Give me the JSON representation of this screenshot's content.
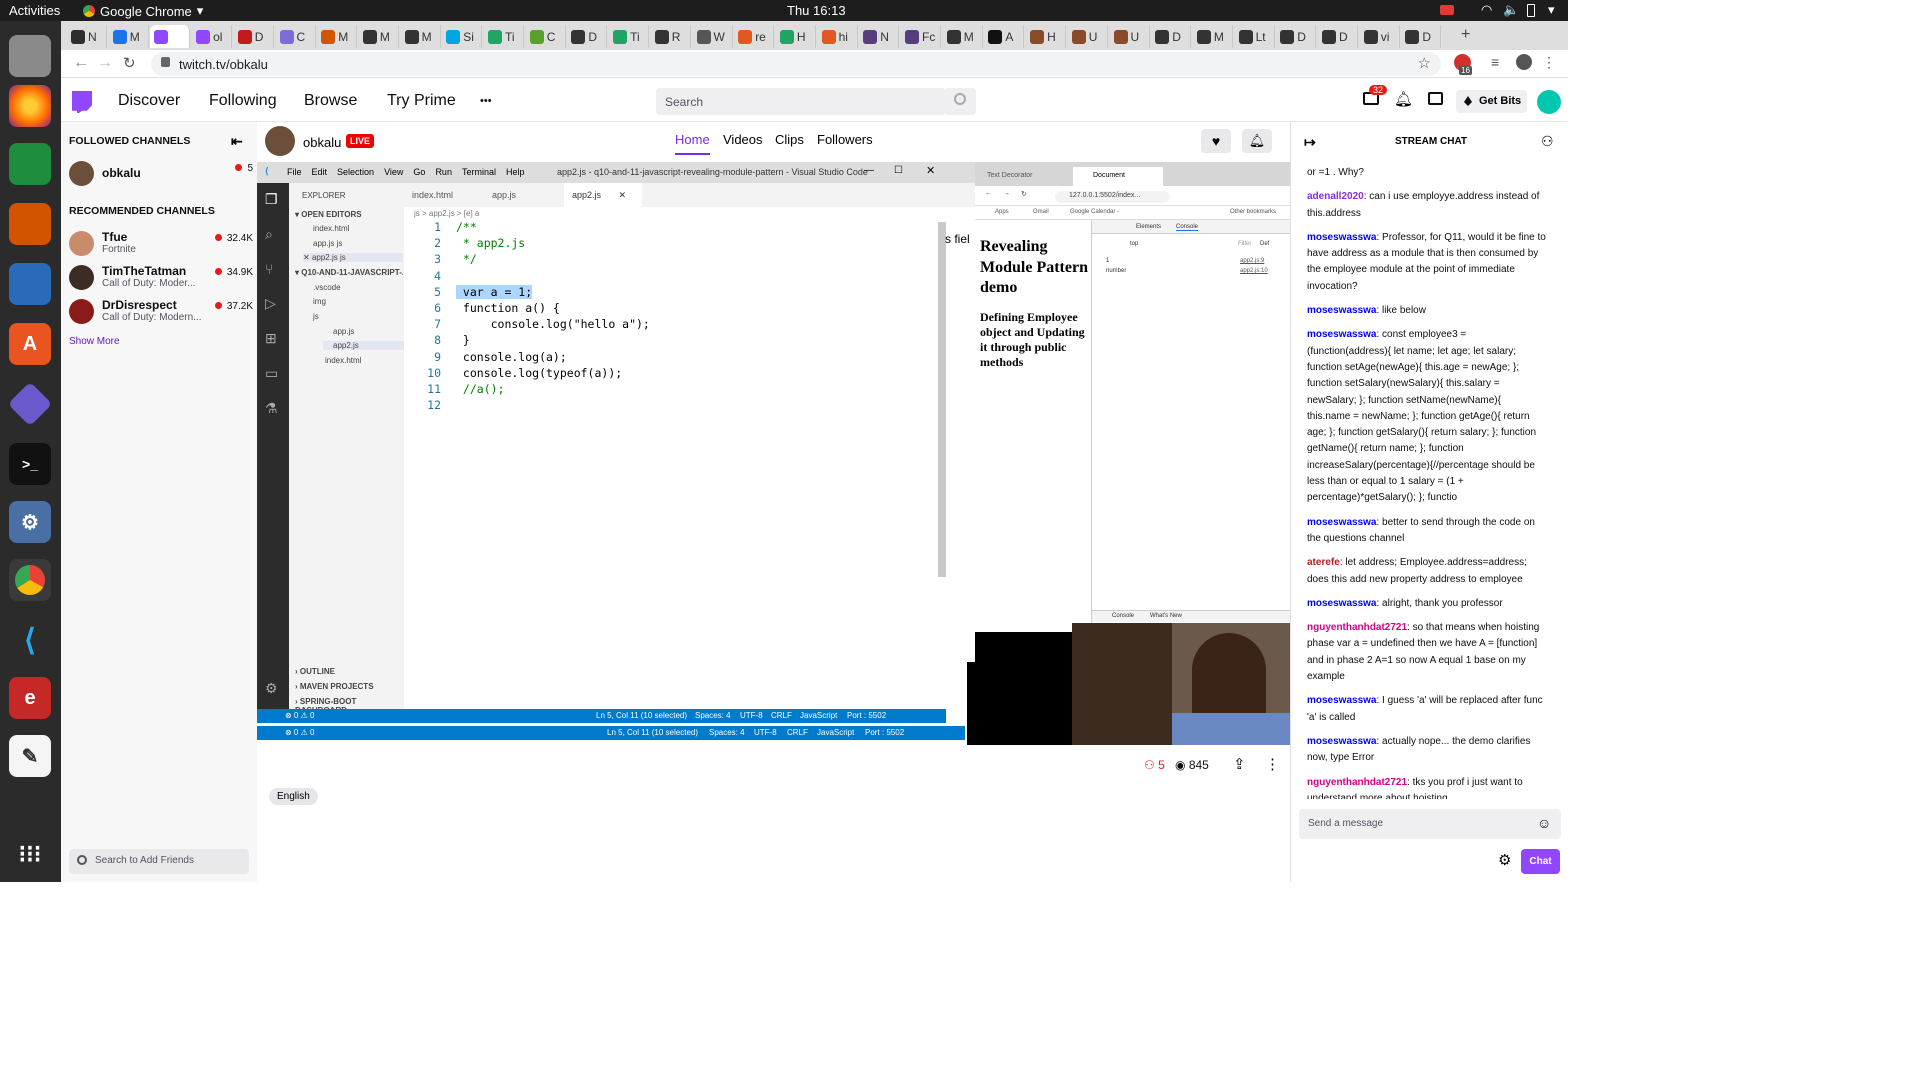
{
  "topbar": {
    "activities": "Activities",
    "app_menu": "Google Chrome",
    "clock": "Thu 16:13"
  },
  "chrome": {
    "tabs": [
      {
        "label": "N",
        "color": "#2d2d2d"
      },
      {
        "label": "M",
        "color": "#1a73e8"
      },
      {
        "label": "",
        "color": "#9146ff",
        "active": true
      },
      {
        "label": "ol",
        "color": "#9146ff"
      },
      {
        "label": "D",
        "color": "#c31a1a"
      },
      {
        "label": "C",
        "color": "#7b6cd9"
      },
      {
        "label": "M",
        "color": "#d35400"
      },
      {
        "label": "M",
        "color": "#333"
      },
      {
        "label": "M",
        "color": "#333"
      },
      {
        "label": "Si",
        "color": "#00a5e3"
      },
      {
        "label": "Ti",
        "color": "#1fa463"
      },
      {
        "label": "C",
        "color": "#5aa02c"
      },
      {
        "label": "D",
        "color": "#333"
      },
      {
        "label": "Ti",
        "color": "#1fa463"
      },
      {
        "label": "R",
        "color": "#333"
      },
      {
        "label": "W",
        "color": "#555"
      },
      {
        "label": "re",
        "color": "#e25822"
      },
      {
        "label": "H",
        "color": "#1fa463"
      },
      {
        "label": "hi",
        "color": "#e25822"
      },
      {
        "label": "N",
        "color": "#563d7c"
      },
      {
        "label": "Fc",
        "color": "#563d7c"
      },
      {
        "label": "M",
        "color": "#333"
      },
      {
        "label": "A",
        "color": "#111"
      },
      {
        "label": "H",
        "color": "#8a4b2a"
      },
      {
        "label": "U",
        "color": "#8a4b2a"
      },
      {
        "label": "U",
        "color": "#8a4b2a"
      },
      {
        "label": "D",
        "color": "#333"
      },
      {
        "label": "M",
        "color": "#333"
      },
      {
        "label": "Lt",
        "color": "#333"
      },
      {
        "label": "D",
        "color": "#333"
      },
      {
        "label": "D",
        "color": "#333"
      },
      {
        "label": "vi",
        "color": "#333"
      },
      {
        "label": "D",
        "color": "#333"
      }
    ],
    "new_tab": "+",
    "url": "twitch.tv/obkalu",
    "ext_badge": "16"
  },
  "twitch": {
    "nav": {
      "discover": "Discover",
      "following": "Following",
      "browse": "Browse",
      "try_prime": "Try Prime",
      "more": "•••",
      "search_placeholder": "Search",
      "inbox_badge": "32",
      "get_bits": "Get Bits"
    },
    "sidebar": {
      "followed_title": "FOLLOWED CHANNELS",
      "followed": [
        {
          "name": "obkalu",
          "viewers": "5",
          "color": "#6b4f3a"
        }
      ],
      "recommended_title": "RECOMMENDED CHANNELS",
      "recommended": [
        {
          "name": "Tfue",
          "game": "Fortnite",
          "viewers": "32.4K",
          "color": "#c98b6b"
        },
        {
          "name": "TimTheTatman",
          "game": "Call of Duty: Moder...",
          "viewers": "34.9K",
          "color": "#3b2d25"
        },
        {
          "name": "DrDisrespect",
          "game": "Call of Duty: Modern...",
          "viewers": "37.2K",
          "color": "#8b1a1a"
        }
      ],
      "show_more": "Show More",
      "search_friends": "Search to Add Friends"
    },
    "channel": {
      "name": "obkalu",
      "live": "LIVE",
      "tabs": [
        "Home",
        "Videos",
        "Clips",
        "Followers"
      ]
    },
    "stats": {
      "viewers": "5",
      "views": "845"
    },
    "tag": "English",
    "chat": {
      "title": "STREAM CHAT",
      "messages": [
        {
          "user": "",
          "color": "#0e0e10",
          "text": "or =1 . Why?"
        },
        {
          "user": "adenall2020",
          "color": "#8a2be2",
          "text": ": can i use employye.address instead of this.address"
        },
        {
          "user": "moseswasswa",
          "color": "#0000ff",
          "text": ": Professor, for Q11, would it be fine to have address as a module that is then consumed by the employee module at the point of immediate invocation?"
        },
        {
          "user": "moseswasswa",
          "color": "#0000ff",
          "text": ": like below"
        },
        {
          "user": "moseswasswa",
          "color": "#0000ff",
          "text": ": const employee3 = (function(address){ let name; let age; let salary; function setAge(newAge){ this.age = newAge; }; function setSalary(newSalary){ this.salary = newSalary; }; function setName(newName){ this.name = newName; }; function getAge(){ return age; }; function getSalary(){ return salary; }; function getName(){ return name; }; function increaseSalary(percentage){//percentage should be less than or equal to 1 salary = (1 + percentage)*getSalary(); }; functio"
        },
        {
          "user": "moseswasswa",
          "color": "#0000ff",
          "text": ": better to send through the code on the questions channel"
        },
        {
          "user": "aterefe",
          "color": "#b22222",
          "text": ": let address; Employee.address=address; does this add new property address to employee"
        },
        {
          "user": "moseswasswa",
          "color": "#0000ff",
          "text": ": alright, thank you professor"
        },
        {
          "user": "nguyenthanhdat2721",
          "color": "#d4008a",
          "text": ": so that means when hoisting phase var a = undefined then we have A = [function] and in phase 2 A=1 so now A equal 1 base on my example"
        },
        {
          "user": "moseswasswa",
          "color": "#0000ff",
          "text": ": I guess 'a' will be replaced after func 'a' is called"
        },
        {
          "user": "moseswasswa",
          "color": "#0000ff",
          "text": ": actually nope... the demo clarifies now, type Error"
        },
        {
          "user": "nguyenthanhdat2721",
          "color": "#d4008a",
          "text": ": tks you prof i just want to understand more about hoisting"
        }
      ],
      "input_placeholder": "Send a message",
      "send": "Chat"
    }
  },
  "vscode": {
    "title": "app2.js - q10-and-11-javascript-revealing-module-pattern - Visual Studio Code",
    "menu": [
      "File",
      "Edit",
      "Selection",
      "View",
      "Go",
      "Run",
      "Terminal",
      "Help"
    ],
    "explorer": {
      "title": "EXPLORER",
      "open_editors": "OPEN EDITORS",
      "open": [
        "index.html",
        "app.js js",
        "app2.js js"
      ],
      "project": "Q10-AND-11-JAVASCRIPT-...",
      "tree": [
        ".vscode",
        "img",
        "js",
        "app.js",
        "app2.js",
        "index.html"
      ],
      "bottom": [
        "OUTLINE",
        "MAVEN PROJECTS",
        "SPRING-BOOT DASHBOARD"
      ]
    },
    "tabs": [
      "index.html",
      "app.js",
      "app2.js"
    ],
    "breadcrumb": "js > app2.js > [e] a",
    "lines": [
      "/**",
      " * app2.js",
      " */",
      "",
      " var a = 1;",
      " function a() {",
      "     console.log(\"hello a\");",
      " }",
      " console.log(a);",
      " console.log(typeof(a));",
      " //a();",
      ""
    ],
    "status": {
      "errors": "⊗ 0 ⚠ 0",
      "pos": "Ln 5, Col 11 (10 selected)",
      "spaces": "Spaces: 4",
      "enc": "UTF-8",
      "eol": "CRLF",
      "lang": "JavaScript",
      "port": "Port : 5502"
    }
  },
  "browser2": {
    "tab1": "Text Decorator",
    "tab2": "Document",
    "url": "127.0.0.1:5502/index...",
    "bookmarks": [
      "Apps",
      "Gmail",
      "Google Calendar -",
      "Other bookmarks"
    ],
    "page_h1": "Revealing Module Pattern demo",
    "page_h2": "Defining Employee object and Updating it through public methods",
    "cut": "s fiel",
    "devtools": {
      "tabs": [
        "Elements",
        "Console"
      ],
      "context": "top",
      "filter": "Filter",
      "default": "Def",
      "out1": "1",
      "out2": "number",
      "src1": "app2.js:9",
      "src2": "app2.js:10",
      "drawer": [
        "Console",
        "What's New"
      ]
    }
  }
}
